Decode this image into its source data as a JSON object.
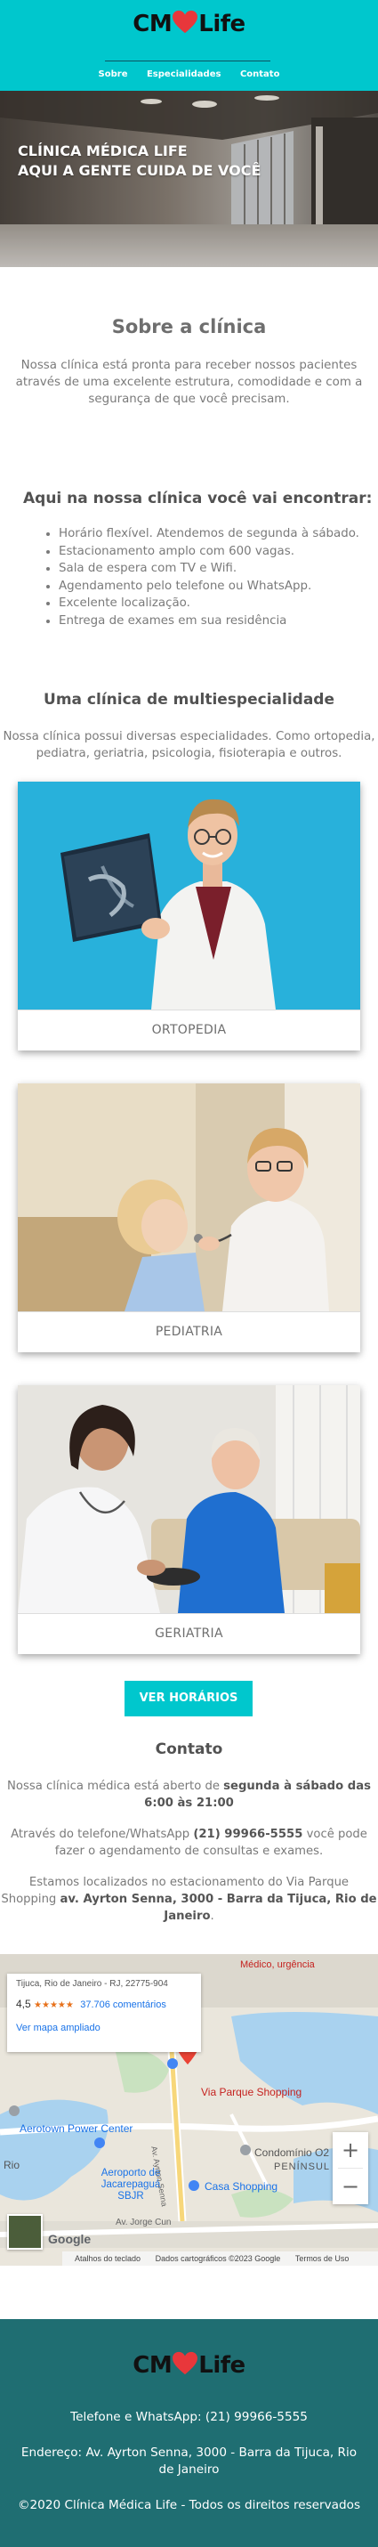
{
  "brand": {
    "logo_left": "CM",
    "logo_right": "Life",
    "heart_color": "#e8373b",
    "accent": "#00c7cd"
  },
  "nav": {
    "items": [
      "Sobre",
      "Especialidades",
      "Contato"
    ]
  },
  "hero": {
    "line1": "CLÍNICA MÉDICA LIFE",
    "line2": "AQUI A GENTE CUIDA DE VOCÊ"
  },
  "about": {
    "title": "Sobre a clínica",
    "text": "Nossa clínica está pronta para receber nossos pacientes através de uma excelente estrutura, comodidade e com a segurança de que você precisam."
  },
  "features": {
    "title": "Aqui na nossa clínica você vai encontrar:",
    "items": [
      "Horário flexível. Atendemos de segunda à sábado.",
      "Estacionamento amplo com 600 vagas.",
      "Sala de espera com TV e Wifi.",
      "Agendamento pelo telefone ou WhatsApp.",
      "Excelente localização.",
      "Entrega de exames em sua residência"
    ]
  },
  "specialties": {
    "title": "Uma clínica de multiespecialidade",
    "text": "Nossa clínica possui diversas especialidades. Como ortopedia, pediatra, geriatria, psicologia, fisioterapia e outros.",
    "cards": [
      "ORTOPEDIA",
      "PEDIATRIA",
      "GERIATRIA"
    ]
  },
  "cta": {
    "label": "VER HORÁRIOS"
  },
  "contact": {
    "title": "Contato",
    "hours_prefix": "Nossa clínica médica está aberto de ",
    "hours_bold": "segunda à sábado das 6:00 às 21:00",
    "phone_prefix": "Através do telefone/WhatsApp ",
    "phone_bold": "(21) 99966-5555",
    "phone_suffix": " você pode fazer o agendamento de consultas e exames.",
    "loc_prefix": "Estamos localizados no estacionamento do Via Parque Shopping ",
    "loc_bold": "av. Ayrton Senna, 3000 - Barra da Tijuca, Rio de Janeiro",
    "loc_suffix": "."
  },
  "map": {
    "address_snippet": "Tijuca, Rio de Janeiro - RJ, 22775-904",
    "rating": "4,5",
    "stars": "★★★★★",
    "reviews": "37.706 comentários",
    "larger_map": "Ver mapa ampliado",
    "top_label": "Médico, urgência",
    "places": [
      "Via Parque Shopping",
      "Aerotown Power Center",
      "Rio",
      "Aeroporto de Jacarepaguá SBJR",
      "Condomínio O2",
      "Casa Shopping",
      "PENÍNSUL",
      "Av. Jorge Cun",
      "Av. Ayrton Senna"
    ],
    "zoom_in": "+",
    "zoom_out": "−",
    "google": "Google",
    "attributions": [
      "Atalhos do teclado",
      "Dados cartográficos ©2023 Google",
      "Termos de Uso"
    ]
  },
  "footer": {
    "phone": "Telefone e WhatsApp: (21) 99966-5555",
    "address": "Endereço: Av. Ayrton Senna, 3000 - Barra da Tijuca, Rio de Janeiro",
    "copyright": "©2020 Clínica Médica Life - Todos os direitos reservados"
  }
}
